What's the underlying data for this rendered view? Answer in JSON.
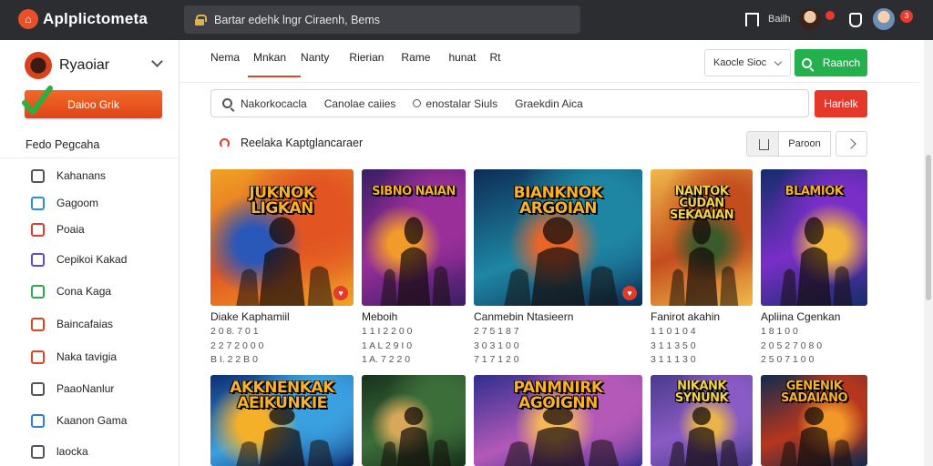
{
  "topbar": {
    "app_title": "Aplplictometa",
    "address": "Bartar edehk lngr Ciraenh, Bems",
    "user_name": "Bailh",
    "badge_1": "",
    "badge_2": "3"
  },
  "sidebar": {
    "brand_name": "Ryaoiar",
    "cta_label": "Daioo Grik",
    "section_head": "Fedo Pegcaha",
    "items": [
      {
        "label": "Kahanans",
        "icon": "document-icon",
        "color": "#555555"
      },
      {
        "label": "Gagoom",
        "icon": "cube-icon",
        "color": "#2a8fd6"
      },
      {
        "label": "Poaia",
        "icon": "google-icon",
        "color": "#e23b2e"
      },
      {
        "label": "Cepikoi Kakad",
        "icon": "puzzle-icon",
        "color": "#5d4bd1"
      },
      {
        "label": "Cona Kaga",
        "icon": "leaf-icon",
        "color": "#2fa84f"
      },
      {
        "label": "Baincafaias",
        "icon": "colorwheel-icon",
        "color": "#d8451e"
      },
      {
        "label": "Naka tavigia",
        "icon": "box-icon",
        "color": "#e2432a"
      },
      {
        "label": "PaaoNanlur",
        "icon": "window-icon",
        "color": "#555555"
      },
      {
        "label": "Kaanon Gama",
        "icon": "apps-icon",
        "color": "#2c7fd5"
      },
      {
        "label": "laocka",
        "icon": "search-icon",
        "color": "#555555"
      }
    ]
  },
  "main": {
    "tabs": [
      "Nema",
      "Mnkan",
      "Nanty",
      "Rierian",
      "Rame",
      "hunat",
      "Rt"
    ],
    "active_tab": 1,
    "select_label": "Kaocle Sioc",
    "search_button": "Raanch",
    "filter_chips": [
      "Nakorkocacla",
      "Canolae caiies",
      "enostalar Siuls",
      "Graekdin Aica"
    ],
    "red_button": "Harielk",
    "section_title": "Reelaka Kaptglancaraer",
    "sort_label": "Paroon",
    "cards_row1": [
      {
        "art_title": "JUKNOK LIGKAN",
        "name": "Diake Kaphamiil",
        "meta": [
          "2 0 8. 7 0 1",
          "2 2 7 2 0 0 0",
          "B I. 2 2 B 0"
        ],
        "fav": "♥",
        "palette": [
          "#f0a325",
          "#e25522",
          "#2a58b8"
        ]
      },
      {
        "art_title": "SIBNO NAIAN",
        "name": "Meboih",
        "meta": [
          "1 1 I 2 2 0 0",
          "1 A L 2 9 I 0",
          "1 A. 7 2 2 0"
        ],
        "fav": "",
        "palette": [
          "#3b1d66",
          "#9a2f9a",
          "#f29a2a"
        ]
      },
      {
        "art_title": "BIANKNOK ARGOIAN",
        "name": "Canmebin Ntasieern",
        "meta": [
          "2 7 5 1 8 7",
          "3 0 3 1 0 0",
          "7 1 7 1 2 0"
        ],
        "fav": "♥",
        "palette": [
          "#0d2c55",
          "#1e86a3",
          "#e9652a"
        ]
      },
      {
        "art_title": "NANTOK CUDAN SEKAAIAN",
        "name": "Fanirot akahin",
        "meta": [
          "1 1 0 1 0 4",
          "3 1 1 3 5 0",
          "3 1 1 1 3 0"
        ],
        "fav": "",
        "palette": [
          "#f0b84a",
          "#c44d1e",
          "#3b5b2a"
        ]
      },
      {
        "art_title": "BLAMIOK",
        "name": "Apliina Cgenkan",
        "meta": [
          "1 8 1 0 0",
          "2 0 5 2 7 0 8 0",
          "2 5 0 7 1 0 0"
        ],
        "fav": "",
        "palette": [
          "#142d6b",
          "#7a2ec8",
          "#f2b53a"
        ]
      }
    ],
    "cards_row2": [
      {
        "art_title": "AKKNENKAK AEIKUNKIE",
        "palette": [
          "#0e2d73",
          "#3aa0e0",
          "#f5b02a"
        ]
      },
      {
        "art_title": "",
        "palette": [
          "#17321c",
          "#3c6e3a",
          "#d8a85a"
        ]
      },
      {
        "art_title": "PANMNIRK AGOIGNN",
        "palette": [
          "#2f2e8f",
          "#b459b8",
          "#f5b75a"
        ]
      },
      {
        "art_title": "NIKANK SYNUNK",
        "palette": [
          "#4a3b8c",
          "#8a5bc4",
          "#e9b54a"
        ]
      },
      {
        "art_title": "GENENIK SADAIANO",
        "palette": [
          "#132b4e",
          "#b6361d",
          "#f2982a"
        ]
      }
    ]
  },
  "colors": {
    "topbar": "#2b2d31",
    "accent_orange": "#e8502a",
    "green": "#22b14c",
    "red": "#e3382a"
  }
}
